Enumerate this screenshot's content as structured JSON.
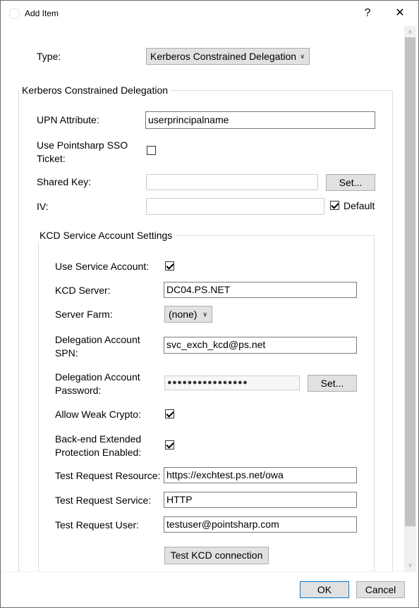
{
  "window": {
    "title": "Add Item",
    "help": "?",
    "close": "✕"
  },
  "type": {
    "label": "Type:",
    "value": "Kerberos Constrained Delegation"
  },
  "kcd_group": {
    "title": "Kerberos Constrained Delegation",
    "upn_label": "UPN Attribute:",
    "upn_value": "userprincipalname",
    "sso_label": "Use Pointsharp SSO Ticket:",
    "sso_checked": false,
    "shared_key_label": "Shared Key:",
    "shared_key_value": "",
    "shared_key_set": "Set...",
    "iv_label": "IV:",
    "iv_value": "",
    "iv_default_label": "Default",
    "iv_default_checked": true
  },
  "service_group": {
    "title": "KCD Service Account Settings",
    "use_service_label": "Use Service Account:",
    "use_service_checked": true,
    "kcd_server_label": "KCD Server:",
    "kcd_server_value": "DC04.PS.NET",
    "server_farm_label": "Server Farm:",
    "server_farm_value": "(none)",
    "spn_label": "Delegation Account SPN:",
    "spn_value": "svc_exch_kcd@ps.net",
    "password_label": "Delegation Account Password:",
    "password_value": "●●●●●●●●●●●●●●●●",
    "password_set": "Set...",
    "weak_crypto_label": "Allow Weak Crypto:",
    "weak_crypto_checked": true,
    "backend_ep_label": "Back-end Extended Protection Enabled:",
    "backend_ep_checked": true,
    "test_resource_label": "Test Request Resource:",
    "test_resource_value": "https://exchtest.ps.net/owa",
    "test_service_label": "Test Request Service:",
    "test_service_value": "HTTP",
    "test_user_label": "Test Request User:",
    "test_user_value": "testuser@pointsharp.com",
    "test_button": "Test KCD connection"
  },
  "footer": {
    "ok": "OK",
    "cancel": "Cancel"
  },
  "icons": {
    "scroll_up": "chevron-up-icon",
    "scroll_down": "chevron-down-icon",
    "check": "checkmark-icon"
  }
}
